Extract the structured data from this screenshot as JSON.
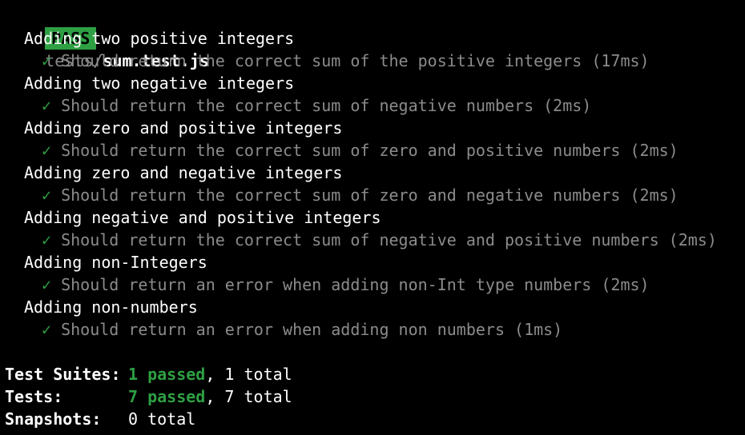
{
  "header": {
    "status": "PASS",
    "path_prefix": "tests/",
    "file": "sum.test.js"
  },
  "suites": [
    {
      "title": "Adding two positive integers",
      "check": "✓",
      "test": "Should return the correct sum of the positive integers (17ms)"
    },
    {
      "title": "Adding two negative integers",
      "check": "✓",
      "test": "Should return the correct sum of negative numbers (2ms)"
    },
    {
      "title": "Adding zero and positive integers",
      "check": "✓",
      "test": "Should return the correct sum of zero and positive numbers (2ms)"
    },
    {
      "title": "Adding zero and negative integers",
      "check": "✓",
      "test": "Should return the correct sum of zero and negative numbers (2ms)"
    },
    {
      "title": "Adding negative and positive integers",
      "check": "✓",
      "test": "Should return the correct sum of negative and positive numbers (2ms)"
    },
    {
      "title": "Adding non-Integers",
      "check": "✓",
      "test": "Should return an error when adding non-Int type numbers (2ms)"
    },
    {
      "title": "Adding non-numbers",
      "check": "✓",
      "test": "Should return an error when adding non numbers (1ms)"
    }
  ],
  "summary": {
    "suites_label": "Test Suites:",
    "suites_passed": "1 passed",
    "suites_total": ", 1 total",
    "tests_label": "Tests:",
    "tests_passed": "7 passed",
    "tests_total": ", 7 total",
    "snapshots_label": "Snapshots:",
    "snapshots_total": "0 total"
  },
  "colors": {
    "pass_green": "#2ea043",
    "dim_gray": "#8b8b8b",
    "background": "#000000"
  }
}
